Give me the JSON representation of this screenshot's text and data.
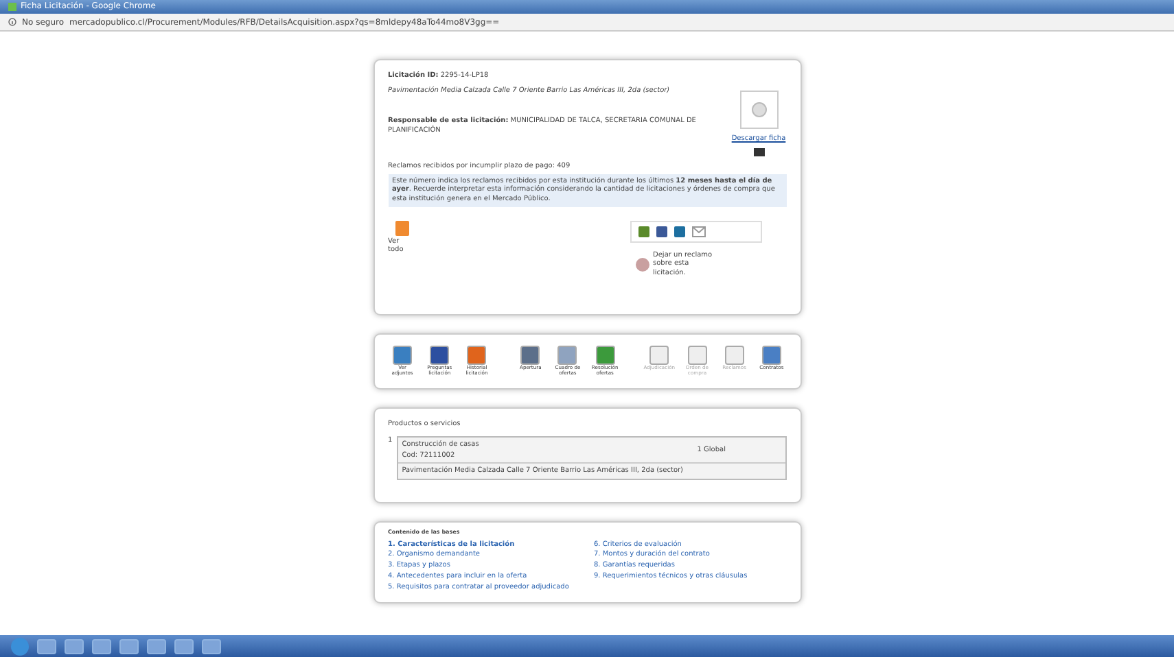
{
  "window": {
    "title": "Ficha Licitación - Google Chrome"
  },
  "address_bar": {
    "security": "No seguro",
    "url": "mercadopublico.cl/Procurement/Modules/RFB/DetailsAcquisition.aspx?qs=8mldepy48aTo44mo8V3gg=="
  },
  "tender": {
    "id_label": "Licitación ID:",
    "id": "2295-14-LP18",
    "name": "Pavimentación Media Calzada Calle 7 Oriente Barrio Las Américas III, 2da (sector)",
    "responsible_label": "Responsable de esta licitación:",
    "responsible": "MUNICIPALIDAD DE TALCA, SECRETARIA COMUNAL DE PLANIFICACIÓN",
    "download": "Descargar ficha",
    "claims_label": "Reclamos recibidos por incumplir plazo de pago:",
    "claims": "409",
    "notice": "Este número indica los reclamos recibidos por esta institución durante los últimos **12 meses hasta el día de ayer**. Recuerde interpretar esta información considerando la cantidad de licitaciones y órdenes de compra que esta institución genera en el Mercado Público.",
    "view_all": "Ver todo",
    "complaint": "Dejar un reclamo sobre esta licitación."
  },
  "toolbar": [
    {
      "label": "Ver adjuntos",
      "disabled": false
    },
    {
      "label": "Preguntas licitación",
      "disabled": false
    },
    {
      "label": "Historial licitación",
      "disabled": false
    },
    {
      "label": "Apertura",
      "disabled": false
    },
    {
      "label": "Cuadro de ofertas",
      "disabled": false
    },
    {
      "label": "Resolución ofertas",
      "disabled": false
    },
    {
      "label": "Adjudicación",
      "disabled": true
    },
    {
      "label": "Orden de compra",
      "disabled": true
    },
    {
      "label": "Reclamos",
      "disabled": true
    },
    {
      "label": "Contratos",
      "disabled": false
    }
  ],
  "products": {
    "title": "Productos o servicios",
    "items": [
      {
        "number": "1",
        "name": "Construcción de casas",
        "code": "Cod: 72111002",
        "quantity": "1 Global",
        "description": "Pavimentación Media Calzada Calle 7 Oriente Barrio Las Américas III, 2da (sector)"
      }
    ]
  },
  "bases": {
    "title": "Contenido de las bases",
    "items": [
      {
        "label": "1. Características de la licitación",
        "selected": true
      },
      {
        "label": "2. Organismo demandante",
        "selected": false
      },
      {
        "label": "3. Etapas y plazos",
        "selected": false
      },
      {
        "label": "4. Antecedentes para incluir en la oferta",
        "selected": false
      },
      {
        "label": "5. Requisitos para contratar al proveedor adjudicado",
        "selected": false
      },
      {
        "label": "6. Criterios de evaluación",
        "selected": false
      },
      {
        "label": "7. Montos y duración del contrato",
        "selected": false
      },
      {
        "label": "8. Garantías requeridas",
        "selected": false
      },
      {
        "label": "9. Requerimientos técnicos y otras cláusulas",
        "selected": false
      }
    ]
  }
}
